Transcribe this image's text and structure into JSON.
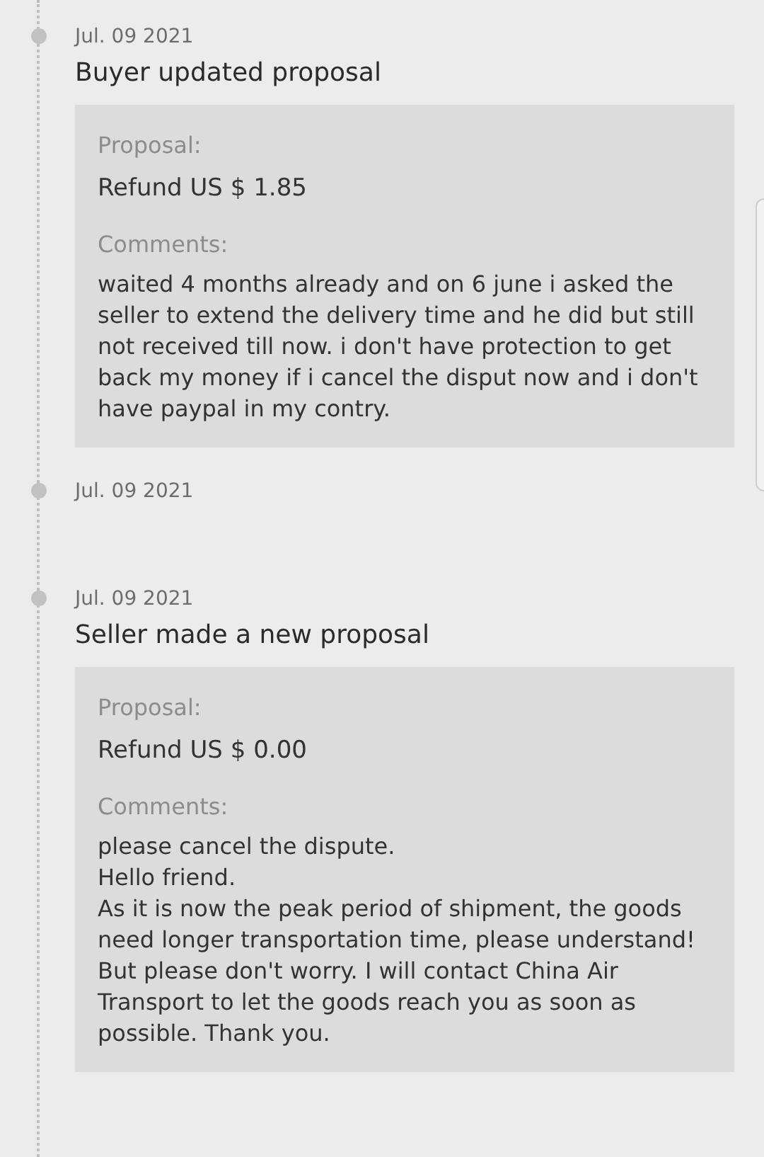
{
  "events": [
    {
      "date": "Jul. 09 2021",
      "title": "Buyer updated proposal",
      "proposal": {
        "label": "Proposal:",
        "value": "Refund US $ 1.85",
        "comments_label": "Comments:",
        "comments": "waited 4 months already and on 6 june i asked the seller to extend the delivery time and he did but still not received till now. i don't have protection to get back my money if i cancel the disput now and i don't have paypal in my contry."
      }
    },
    {
      "date": "Jul. 09 2021"
    },
    {
      "date": "Jul. 09 2021",
      "title": "Seller made a new proposal",
      "proposal": {
        "label": "Proposal:",
        "value": "Refund US $ 0.00",
        "comments_label": "Comments:",
        "comments": "please cancel the dispute.\nHello friend.\nAs it is now the peak period of shipment, the goods need longer transportation time, please understand!\nBut please don't worry. I will contact China Air Transport to let the goods reach you as soon as possible. Thank you."
      }
    }
  ]
}
